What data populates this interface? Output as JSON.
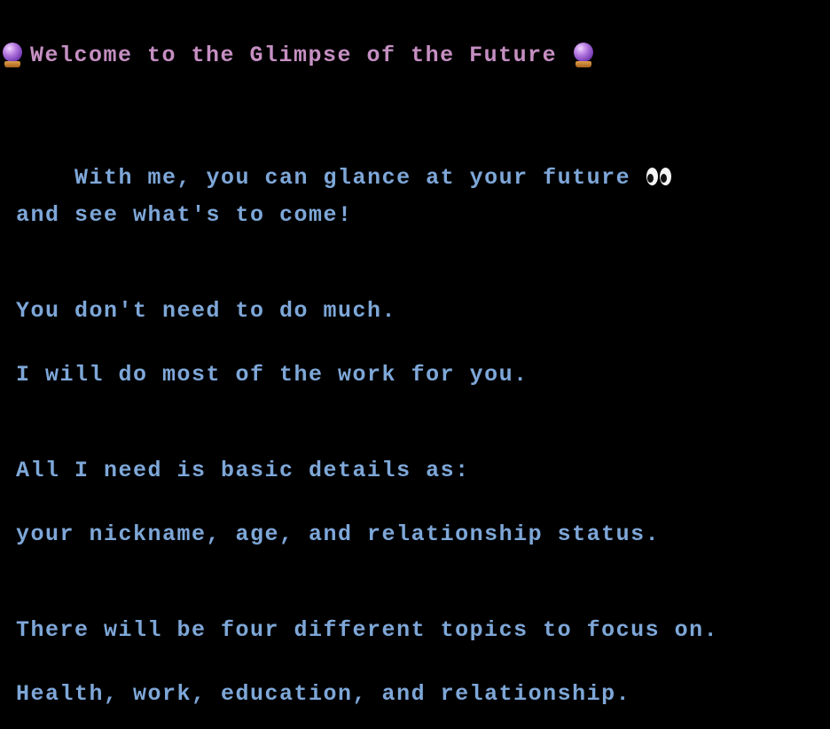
{
  "title": {
    "text": "Welcome to the Glimpse of the Future",
    "left_icon": "crystal-ball-icon",
    "right_icon": "crystal-ball-icon",
    "color": "#c58fc2"
  },
  "body_color": "#7ea7d8",
  "background": "#000000",
  "paragraphs": [
    {
      "lines": [
        "With me, you can glance at your future",
        "and see what's to come!"
      ],
      "trailing_icon": "eyes-icon"
    },
    {
      "lines": [
        "You don't need to do much.",
        "I will do most of the work for you."
      ]
    },
    {
      "lines": [
        "All I need is basic details as:",
        "your nickname, age, and relationship status."
      ]
    },
    {
      "lines": [
        "There will be four different topics to focus on.",
        "Health, work, education, and relationship."
      ]
    }
  ]
}
